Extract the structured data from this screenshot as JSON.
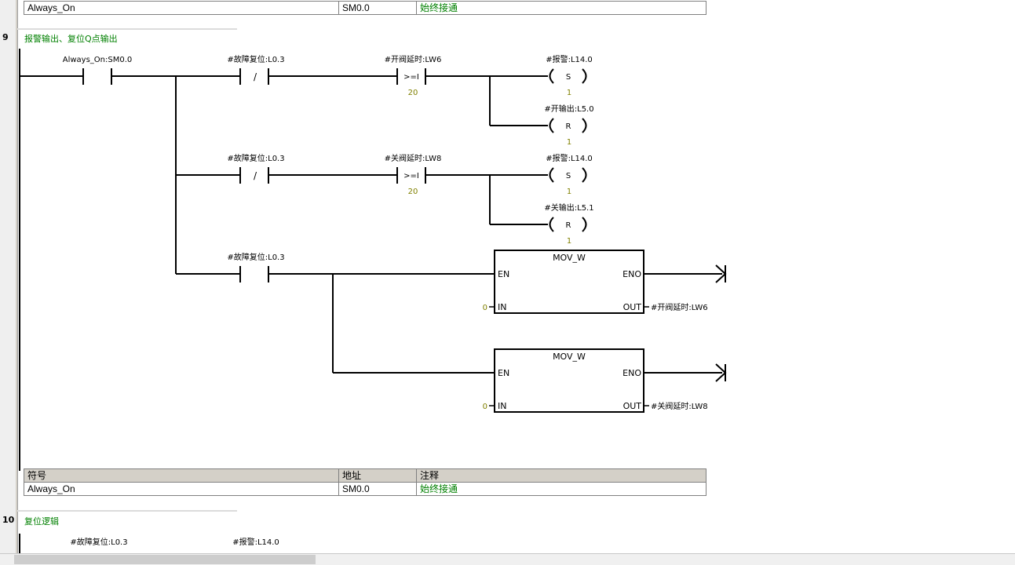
{
  "top_table": {
    "row": {
      "symbol": "Always_On",
      "address": "SM0.0",
      "comment": "始终接通"
    }
  },
  "network9": {
    "number": "9",
    "title": "报警输出、复位Q点输出",
    "contact_always_on": "Always_On:SM0.0",
    "rung1": {
      "reset_contact": "#故障复位:L0.3",
      "compare_label": "#开阀延时:LW6",
      "compare_op": ">=I",
      "compare_value": "20",
      "set_coil_label": "#报警:L14.0",
      "set_coil_op": "S",
      "set_coil_n": "1",
      "reset_coil_label": "#开输出:L5.0",
      "reset_coil_op": "R",
      "reset_coil_n": "1"
    },
    "rung2": {
      "reset_contact": "#故障复位:L0.3",
      "compare_label": "#关阀延时:LW8",
      "compare_op": ">=I",
      "compare_value": "20",
      "set_coil_label": "#报警:L14.0",
      "set_coil_op": "S",
      "set_coil_n": "1",
      "reset_coil_label": "#关输出:L5.1",
      "reset_coil_op": "R",
      "reset_coil_n": "1"
    },
    "rung3": {
      "contact": "#故障复位:L0.3",
      "box1": {
        "title": "MOV_W",
        "en": "EN",
        "eno": "ENO",
        "in": "IN",
        "out": "OUT",
        "in_value": "0",
        "out_value": "#开阀延时:LW6"
      },
      "box2": {
        "title": "MOV_W",
        "en": "EN",
        "eno": "ENO",
        "in": "IN",
        "out": "OUT",
        "in_value": "0",
        "out_value": "#关阀延时:LW8"
      }
    },
    "negate_symbol": "/",
    "table": {
      "headers": [
        "符号",
        "地址",
        "注释"
      ],
      "row": {
        "symbol": "Always_On",
        "address": "SM0.0",
        "comment": "始终接通"
      }
    }
  },
  "network10": {
    "number": "10",
    "title": "复位逻辑",
    "contact": "#故障复位:L0.3",
    "coil": "#报警:L14.0"
  },
  "colors": {
    "comment_green": "#008000",
    "value_olive": "#808000",
    "gutter": "#efefef",
    "header_gray": "#d4d0c8"
  }
}
